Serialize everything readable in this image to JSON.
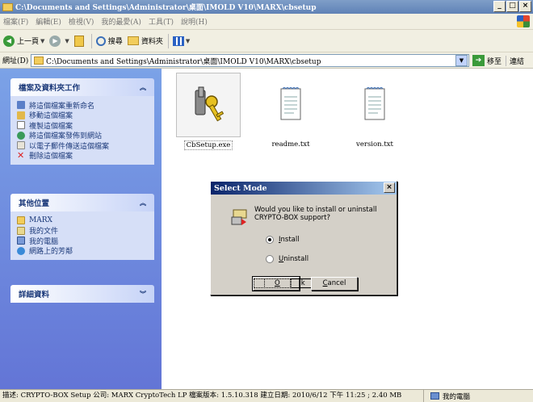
{
  "window": {
    "title": "C:\\Documents and Settings\\Administrator\\桌面\\IMOLD V10\\MARX\\cbsetup"
  },
  "menu": [
    "檔案(F)",
    "編輯(E)",
    "檢視(V)",
    "我的最愛(A)",
    "工具(T)",
    "說明(H)"
  ],
  "toolbar": {
    "back": "上一頁",
    "search": "搜尋",
    "folders": "資料夾"
  },
  "address": {
    "label": "網址(D)",
    "value": "C:\\Documents and Settings\\Administrator\\桌面\\IMOLD V10\\MARX\\cbsetup",
    "go": "移至",
    "links": "連結"
  },
  "sidebar": {
    "tasks": {
      "title": "檔案及資料夾工作",
      "items": [
        "將這個檔案重新命名",
        "移動這個檔案",
        "複製這個檔案",
        "將這個檔案發佈到網站",
        "以電子郵件傳送這個檔案",
        "刪除這個檔案"
      ]
    },
    "places": {
      "title": "其他位置",
      "items": [
        "MARX",
        "我的文件",
        "我的電腦",
        "網路上的芳鄰"
      ]
    },
    "details": {
      "title": "詳細資料"
    }
  },
  "files": [
    {
      "name": "CbSetup.exe",
      "icon": "setup-keys-icon"
    },
    {
      "name": "readme.txt",
      "icon": "text-file-icon"
    },
    {
      "name": "version.txt",
      "icon": "text-file-icon"
    }
  ],
  "dialog": {
    "title": "Select Mode",
    "message": "Would you like to install or uninstall CRYPTO-BOX support?",
    "option_install_u": "I",
    "option_install_rest": "nstall",
    "option_uninstall_u": "U",
    "option_uninstall_rest": "ninstall",
    "ok_u": "O",
    "ok_rest": "k",
    "cancel_u": "C",
    "cancel_rest": "ancel"
  },
  "status": {
    "description": "描述: CRYPTO-BOX Setup 公司: MARX CryptoTech LP 檔案版本: 1.5.10.318 建立日期: 2010/6/12 下午 11:25 ; 2.40 MB",
    "zone": "我的電腦"
  },
  "colors": {
    "titlebar": "#6b8cc0",
    "sidebar": "#7090e0",
    "dialog_title": "#0a246a"
  }
}
